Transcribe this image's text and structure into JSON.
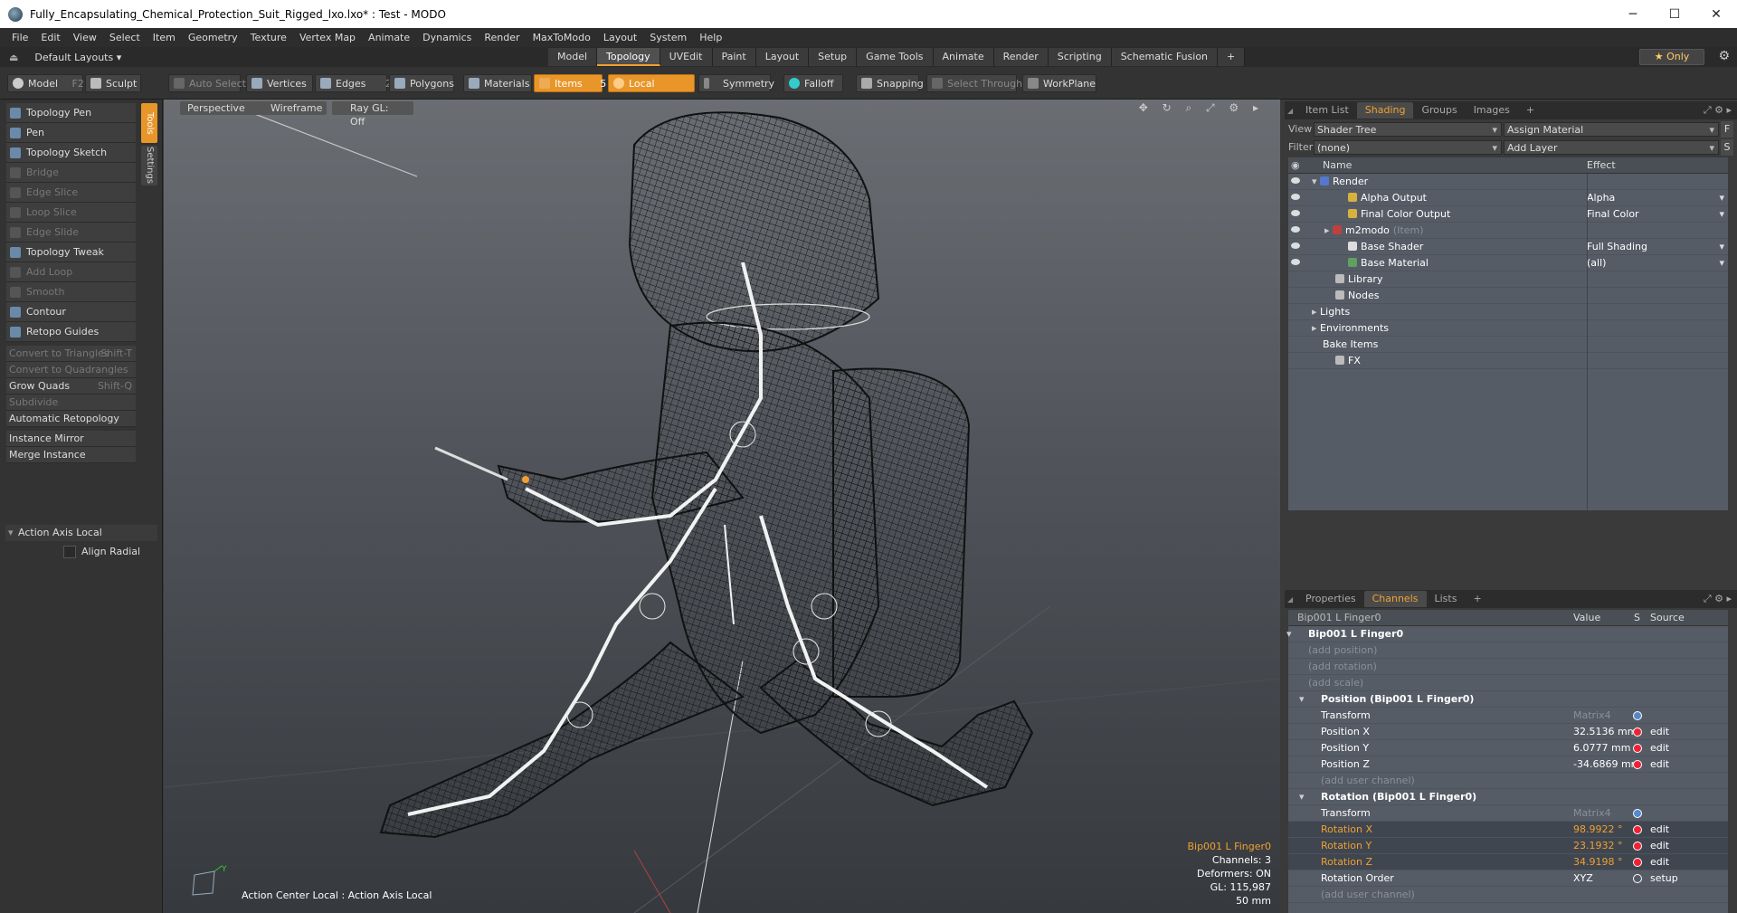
{
  "window": {
    "title": "Fully_Encapsulating_Chemical_Protection_Suit_Rigged_lxo.lxo* : Test - MODO",
    "minimize": "─",
    "maximize": "☐",
    "close": "✕"
  },
  "menu": [
    "File",
    "Edit",
    "View",
    "Select",
    "Item",
    "Geometry",
    "Texture",
    "Vertex Map",
    "Animate",
    "Dynamics",
    "Render",
    "MaxToModo",
    "Layout",
    "System",
    "Help"
  ],
  "layoutbar": {
    "layouts_label": "Default Layouts ▾",
    "tabs": [
      "Model",
      "Topology",
      "UVEdit",
      "Paint",
      "Layout",
      "Setup",
      "Game Tools",
      "Animate",
      "Render",
      "Scripting",
      "Schematic Fusion"
    ],
    "active_tab": "Topology",
    "add": "+",
    "only": "★ Only"
  },
  "toolbar": {
    "model": "Model",
    "model_key": "F2",
    "sculpt": "Sculpt",
    "auto_select": "Auto Select",
    "vertices": "Vertices",
    "vertices_key": "1",
    "edges": "Edges",
    "edges_key": "2",
    "polygons": "Polygons",
    "materials": "Materials",
    "items": "Items",
    "items_key": "5",
    "local": "Local",
    "symmetry": "Symmetry",
    "falloff": "Falloff",
    "snapping": "Snapping",
    "select_through": "Select Through",
    "workplane": "WorkPlane"
  },
  "tools": {
    "items": [
      {
        "label": "Topology Pen",
        "enabled": true
      },
      {
        "label": "Pen",
        "enabled": true
      },
      {
        "label": "Topology Sketch",
        "enabled": true
      },
      {
        "label": "Bridge",
        "enabled": false
      },
      {
        "label": "Edge Slice",
        "enabled": false
      },
      {
        "label": "Loop Slice",
        "enabled": false
      },
      {
        "label": "Edge Slide",
        "enabled": false
      },
      {
        "label": "Topology Tweak",
        "enabled": true
      },
      {
        "label": "Add Loop",
        "enabled": false
      },
      {
        "label": "Smooth",
        "enabled": false
      },
      {
        "label": "Contour",
        "enabled": true
      },
      {
        "label": "Retopo Guides",
        "enabled": true
      }
    ],
    "commands": [
      {
        "label": "Convert to Triangles",
        "shortcut": "Shift-T",
        "enabled": false
      },
      {
        "label": "Convert to Quadrangles",
        "shortcut": "",
        "enabled": false
      },
      {
        "label": "Grow Quads",
        "shortcut": "Shift-Q",
        "enabled": true
      },
      {
        "label": "Subdivide",
        "shortcut": "",
        "enabled": false
      },
      {
        "label": "Automatic Retopology",
        "shortcut": "",
        "enabled": true
      }
    ],
    "commands2": [
      "Instance Mirror",
      "Merge Instance"
    ],
    "side_tabs": [
      "Tools",
      "Settings"
    ],
    "action_axis": "Action Axis Local",
    "align_radial": "Align Radial"
  },
  "viewport": {
    "perspective": "Perspective",
    "wireframe": "Wireframe",
    "raygl": "Ray GL: Off",
    "icons": "✥ ↻ ⌕ ⤢ ⚙ ▸",
    "action_center": "Action Center Local : Action Axis Local",
    "info": {
      "selected": "Bip001 L Finger0",
      "channels": "Channels: 3",
      "deformers": "Deformers: ON",
      "gl": "GL: 115,987",
      "scale": "50 mm"
    },
    "axis_y": "Y"
  },
  "shading_panel": {
    "tabs": [
      "Item List",
      "Shading",
      "Groups",
      "Images"
    ],
    "active_tab": "Shading",
    "add": "+",
    "view_label": "View",
    "view_value": "Shader Tree",
    "assign_material": "Assign Material",
    "f": "F",
    "filter_label": "Filter",
    "filter_value": "(none)",
    "add_layer": "Add Layer",
    "s": "S",
    "col_name": "Name",
    "col_effect": "Effect",
    "rows": [
      {
        "name": "Render",
        "effect": "",
        "indent": 0,
        "eye": true,
        "color": "#5577cc",
        "arrow": "▾"
      },
      {
        "name": "Alpha Output",
        "effect": "Alpha",
        "indent": 2,
        "eye": true,
        "color": "#d8b040",
        "arrow": ""
      },
      {
        "name": "Final Color Output",
        "effect": "Final Color",
        "indent": 2,
        "eye": true,
        "color": "#d8b040",
        "arrow": ""
      },
      {
        "name": "m2modo",
        "effect": "",
        "indent": 1,
        "eye": true,
        "color": "#c04040",
        "arrow": "▸",
        "suffix": "(Item)"
      },
      {
        "name": "Base Shader",
        "effect": "Full Shading",
        "indent": 2,
        "eye": true,
        "color": "#dddddd",
        "arrow": ""
      },
      {
        "name": "Base Material",
        "effect": "(all)",
        "indent": 2,
        "eye": true,
        "color": "#60a060",
        "arrow": ""
      },
      {
        "name": "Library",
        "effect": "",
        "indent": 1,
        "eye": false,
        "color": "",
        "arrow": ""
      },
      {
        "name": "Nodes",
        "effect": "",
        "indent": 1,
        "eye": false,
        "color": "",
        "arrow": ""
      },
      {
        "name": "Lights",
        "effect": "",
        "indent": 0,
        "eye": false,
        "color": "",
        "arrow": "▸"
      },
      {
        "name": "Environments",
        "effect": "",
        "indent": 0,
        "eye": false,
        "color": "",
        "arrow": "▸"
      },
      {
        "name": "Bake Items",
        "effect": "",
        "indent": 0,
        "eye": false,
        "color": "",
        "arrow": ""
      },
      {
        "name": "FX",
        "effect": "",
        "indent": 1,
        "eye": false,
        "color": "",
        "arrow": ""
      }
    ]
  },
  "channels_panel": {
    "tabs": [
      "Properties",
      "Channels",
      "Lists"
    ],
    "active_tab": "Channels",
    "add": "+",
    "col_name": "Bip001 L Finger0",
    "col_value": "Value",
    "col_s": "S",
    "col_source": "Source",
    "rows": [
      {
        "name": "Bip001 L Finger0",
        "value": "",
        "source": "",
        "style": "bold",
        "indent": 0,
        "dot": ""
      },
      {
        "name": "(add position)",
        "value": "",
        "source": "",
        "style": "gray",
        "indent": 1,
        "dot": ""
      },
      {
        "name": "(add rotation)",
        "value": "",
        "source": "",
        "style": "gray",
        "indent": 1,
        "dot": ""
      },
      {
        "name": "(add scale)",
        "value": "",
        "source": "",
        "style": "gray",
        "indent": 1,
        "dot": ""
      },
      {
        "name": "Position (Bip001 L Finger0)",
        "value": "",
        "source": "",
        "style": "bold",
        "indent": 1,
        "dot": ""
      },
      {
        "name": "Transform",
        "value": "Matrix4",
        "source": "",
        "style": "",
        "indent": 2,
        "dot": "blue"
      },
      {
        "name": "Position X",
        "value": "32.5136 mm",
        "source": "edit",
        "style": "",
        "indent": 2,
        "dot": "red"
      },
      {
        "name": "Position Y",
        "value": "6.0777 mm",
        "source": "edit",
        "style": "",
        "indent": 2,
        "dot": "red"
      },
      {
        "name": "Position Z",
        "value": "-34.6869 mm",
        "source": "edit",
        "style": "",
        "indent": 2,
        "dot": "red"
      },
      {
        "name": "(add user channel)",
        "value": "",
        "source": "",
        "style": "gray",
        "indent": 2,
        "dot": ""
      },
      {
        "name": "Rotation (Bip001 L Finger0)",
        "value": "",
        "source": "",
        "style": "bold",
        "indent": 1,
        "dot": ""
      },
      {
        "name": "Transform",
        "value": "Matrix4",
        "source": "",
        "style": "",
        "indent": 2,
        "dot": "blue"
      },
      {
        "name": "Rotation X",
        "value": "98.9922 °",
        "source": "edit",
        "style": "sel",
        "indent": 2,
        "dot": "red"
      },
      {
        "name": "Rotation Y",
        "value": "23.1932 °",
        "source": "edit",
        "style": "sel",
        "indent": 2,
        "dot": "red"
      },
      {
        "name": "Rotation Z",
        "value": "34.9198 °",
        "source": "edit",
        "style": "sel",
        "indent": 2,
        "dot": "red"
      },
      {
        "name": "Rotation Order",
        "value": "XYZ",
        "source": "setup",
        "style": "",
        "indent": 2,
        "dot": "hollow"
      },
      {
        "name": "(add user channel)",
        "value": "",
        "source": "",
        "style": "gray",
        "indent": 2,
        "dot": ""
      }
    ]
  }
}
